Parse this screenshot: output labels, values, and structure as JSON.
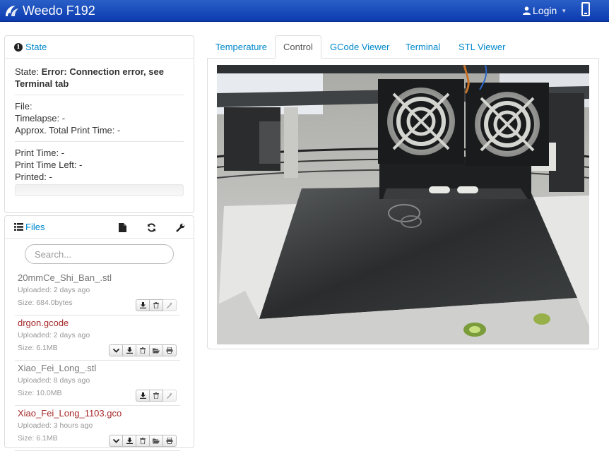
{
  "navbar": {
    "brand": "Weedo F192",
    "login_label": "Login",
    "brand_icon": "octoprint-logo-icon",
    "mobile_icon": "mobile-icon"
  },
  "state": {
    "title": "State",
    "state_label": "State:",
    "state_value": "Error: Connection error, see Terminal tab",
    "file_label": "File:",
    "file_value": "",
    "timelapse_label": "Timelapse:",
    "timelapse_value": "-",
    "approx_label": "Approx. Total Print Time:",
    "approx_value": "-",
    "print_time_label": "Print Time:",
    "print_time_value": "-",
    "time_left_label": "Print Time Left:",
    "time_left_value": "-",
    "printed_label": "Printed:",
    "printed_value": "-",
    "progress": 0
  },
  "files": {
    "title": "Files",
    "search_placeholder": "Search...",
    "items": [
      {
        "name": "20mmCe_Shi_Ban_.stl",
        "type": "stl",
        "uploaded": "Uploaded: 2 days ago",
        "size": "Size: 684.0bytes"
      },
      {
        "name": "drgon.gcode",
        "type": "gcode",
        "uploaded": "Uploaded: 2 days ago",
        "size": "Size: 6.1MB"
      },
      {
        "name": "Xiao_Fei_Long_.stl",
        "type": "stl",
        "uploaded": "Uploaded: 8 days ago",
        "size": "Size: 10.0MB"
      },
      {
        "name": "Xiao_Fei_Long_1103.gco",
        "type": "gcode",
        "uploaded": "Uploaded: 3 hours ago",
        "size": "Size: 6.1MB"
      }
    ]
  },
  "tabs": [
    {
      "label": "Temperature"
    },
    {
      "label": "Control"
    },
    {
      "label": "GCode Viewer"
    },
    {
      "label": "Terminal"
    },
    {
      "label": "STL Viewer"
    }
  ],
  "active_tab": "Control",
  "colors": {
    "navbar": "#1a4cbc",
    "link": "#0088cc",
    "gcode_name": "#a62a2a"
  }
}
